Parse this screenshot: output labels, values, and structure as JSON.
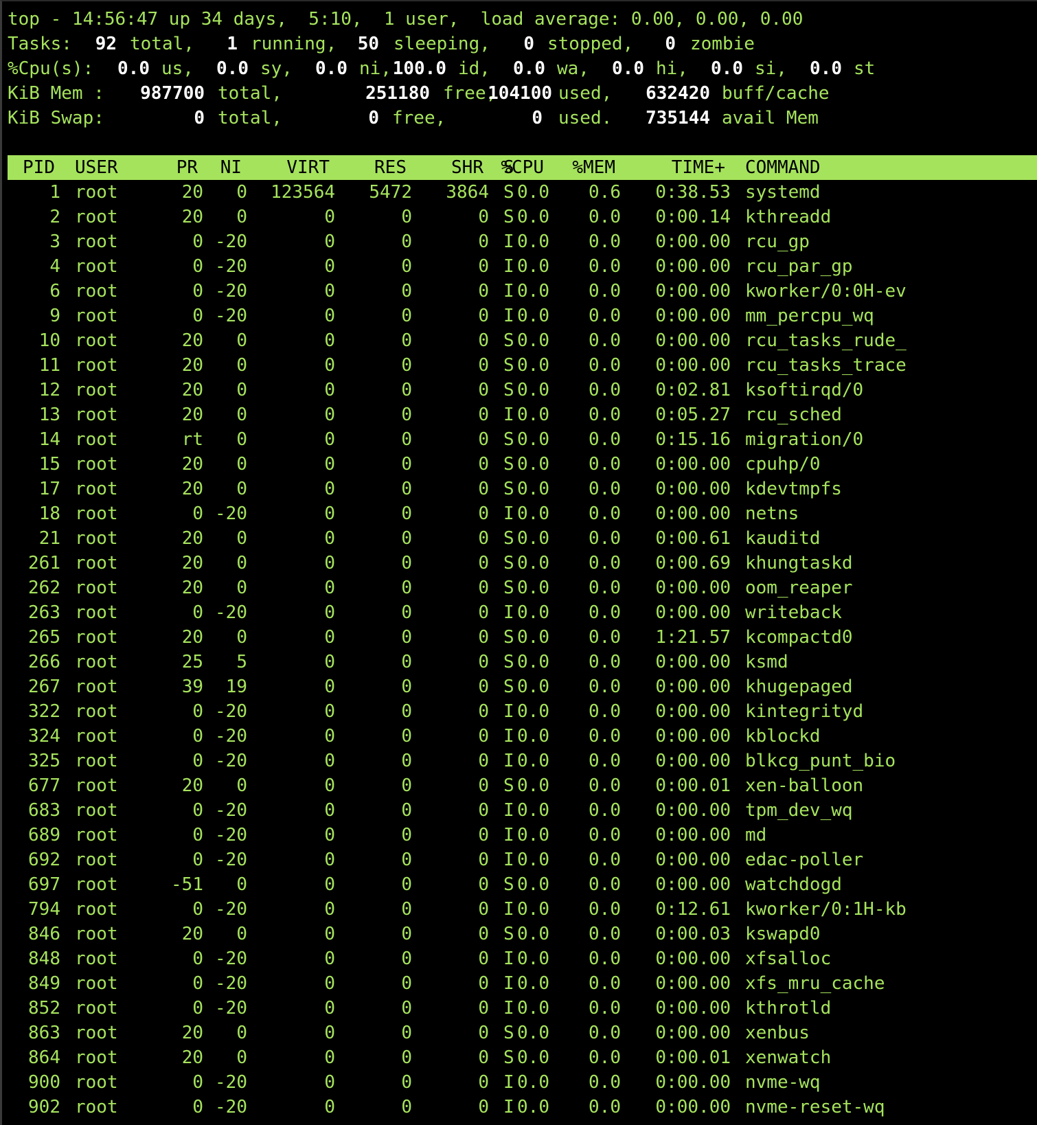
{
  "summary": {
    "line1": "top - 14:56:47 up 34 days,  5:10,  1 user,  load average: 0.00, 0.00, 0.00",
    "tasks": {
      "label": "Tasks:",
      "total": "92",
      "total_lbl": "total,",
      "running": "1",
      "running_lbl": "running,",
      "sleeping": "50",
      "sleeping_lbl": "sleeping,",
      "stopped": "0",
      "stopped_lbl": "stopped,",
      "zombie": "0",
      "zombie_lbl": "zombie"
    },
    "cpu": {
      "label": "%Cpu(s):",
      "us": "0.0",
      "us_lbl": "us,",
      "sy": "0.0",
      "sy_lbl": "sy,",
      "ni": "0.0",
      "ni_lbl": "ni,",
      "id": "100.0",
      "id_lbl": "id,",
      "wa": "0.0",
      "wa_lbl": "wa,",
      "hi": "0.0",
      "hi_lbl": "hi,",
      "si": "0.0",
      "si_lbl": "si,",
      "st": "0.0",
      "st_lbl": "st"
    },
    "mem": {
      "label": "KiB Mem :",
      "total": "987700",
      "total_lbl": "total,",
      "free": "251180",
      "free_lbl": "free,",
      "used": "104100",
      "used_lbl": "used,",
      "buff": "632420",
      "buff_lbl": "buff/cache"
    },
    "swap": {
      "label": "KiB Swap:",
      "total": "0",
      "total_lbl": "total,",
      "free": "0",
      "free_lbl": "free,",
      "used": "0",
      "used_lbl": "used.",
      "avail": "735144",
      "avail_lbl": "avail Mem"
    }
  },
  "columns": [
    "PID",
    "USER",
    "PR",
    "NI",
    "VIRT",
    "RES",
    "SHR",
    "S",
    "%CPU",
    "%MEM",
    "TIME+",
    "COMMAND"
  ],
  "processes": [
    [
      "1",
      "root",
      "20",
      "0",
      "123564",
      "5472",
      "3864",
      "S",
      "0.0",
      "0.6",
      "0:38.53",
      "systemd"
    ],
    [
      "2",
      "root",
      "20",
      "0",
      "0",
      "0",
      "0",
      "S",
      "0.0",
      "0.0",
      "0:00.14",
      "kthreadd"
    ],
    [
      "3",
      "root",
      "0",
      "-20",
      "0",
      "0",
      "0",
      "I",
      "0.0",
      "0.0",
      "0:00.00",
      "rcu_gp"
    ],
    [
      "4",
      "root",
      "0",
      "-20",
      "0",
      "0",
      "0",
      "I",
      "0.0",
      "0.0",
      "0:00.00",
      "rcu_par_gp"
    ],
    [
      "6",
      "root",
      "0",
      "-20",
      "0",
      "0",
      "0",
      "I",
      "0.0",
      "0.0",
      "0:00.00",
      "kworker/0:0H-ev"
    ],
    [
      "9",
      "root",
      "0",
      "-20",
      "0",
      "0",
      "0",
      "I",
      "0.0",
      "0.0",
      "0:00.00",
      "mm_percpu_wq"
    ],
    [
      "10",
      "root",
      "20",
      "0",
      "0",
      "0",
      "0",
      "S",
      "0.0",
      "0.0",
      "0:00.00",
      "rcu_tasks_rude_"
    ],
    [
      "11",
      "root",
      "20",
      "0",
      "0",
      "0",
      "0",
      "S",
      "0.0",
      "0.0",
      "0:00.00",
      "rcu_tasks_trace"
    ],
    [
      "12",
      "root",
      "20",
      "0",
      "0",
      "0",
      "0",
      "S",
      "0.0",
      "0.0",
      "0:02.81",
      "ksoftirqd/0"
    ],
    [
      "13",
      "root",
      "20",
      "0",
      "0",
      "0",
      "0",
      "I",
      "0.0",
      "0.0",
      "0:05.27",
      "rcu_sched"
    ],
    [
      "14",
      "root",
      "rt",
      "0",
      "0",
      "0",
      "0",
      "S",
      "0.0",
      "0.0",
      "0:15.16",
      "migration/0"
    ],
    [
      "15",
      "root",
      "20",
      "0",
      "0",
      "0",
      "0",
      "S",
      "0.0",
      "0.0",
      "0:00.00",
      "cpuhp/0"
    ],
    [
      "17",
      "root",
      "20",
      "0",
      "0",
      "0",
      "0",
      "S",
      "0.0",
      "0.0",
      "0:00.00",
      "kdevtmpfs"
    ],
    [
      "18",
      "root",
      "0",
      "-20",
      "0",
      "0",
      "0",
      "I",
      "0.0",
      "0.0",
      "0:00.00",
      "netns"
    ],
    [
      "21",
      "root",
      "20",
      "0",
      "0",
      "0",
      "0",
      "S",
      "0.0",
      "0.0",
      "0:00.61",
      "kauditd"
    ],
    [
      "261",
      "root",
      "20",
      "0",
      "0",
      "0",
      "0",
      "S",
      "0.0",
      "0.0",
      "0:00.69",
      "khungtaskd"
    ],
    [
      "262",
      "root",
      "20",
      "0",
      "0",
      "0",
      "0",
      "S",
      "0.0",
      "0.0",
      "0:00.00",
      "oom_reaper"
    ],
    [
      "263",
      "root",
      "0",
      "-20",
      "0",
      "0",
      "0",
      "I",
      "0.0",
      "0.0",
      "0:00.00",
      "writeback"
    ],
    [
      "265",
      "root",
      "20",
      "0",
      "0",
      "0",
      "0",
      "S",
      "0.0",
      "0.0",
      "1:21.57",
      "kcompactd0"
    ],
    [
      "266",
      "root",
      "25",
      "5",
      "0",
      "0",
      "0",
      "S",
      "0.0",
      "0.0",
      "0:00.00",
      "ksmd"
    ],
    [
      "267",
      "root",
      "39",
      "19",
      "0",
      "0",
      "0",
      "S",
      "0.0",
      "0.0",
      "0:00.00",
      "khugepaged"
    ],
    [
      "322",
      "root",
      "0",
      "-20",
      "0",
      "0",
      "0",
      "I",
      "0.0",
      "0.0",
      "0:00.00",
      "kintegrityd"
    ],
    [
      "324",
      "root",
      "0",
      "-20",
      "0",
      "0",
      "0",
      "I",
      "0.0",
      "0.0",
      "0:00.00",
      "kblockd"
    ],
    [
      "325",
      "root",
      "0",
      "-20",
      "0",
      "0",
      "0",
      "I",
      "0.0",
      "0.0",
      "0:00.00",
      "blkcg_punt_bio"
    ],
    [
      "677",
      "root",
      "20",
      "0",
      "0",
      "0",
      "0",
      "S",
      "0.0",
      "0.0",
      "0:00.01",
      "xen-balloon"
    ],
    [
      "683",
      "root",
      "0",
      "-20",
      "0",
      "0",
      "0",
      "I",
      "0.0",
      "0.0",
      "0:00.00",
      "tpm_dev_wq"
    ],
    [
      "689",
      "root",
      "0",
      "-20",
      "0",
      "0",
      "0",
      "I",
      "0.0",
      "0.0",
      "0:00.00",
      "md"
    ],
    [
      "692",
      "root",
      "0",
      "-20",
      "0",
      "0",
      "0",
      "I",
      "0.0",
      "0.0",
      "0:00.00",
      "edac-poller"
    ],
    [
      "697",
      "root",
      "-51",
      "0",
      "0",
      "0",
      "0",
      "S",
      "0.0",
      "0.0",
      "0:00.00",
      "watchdogd"
    ],
    [
      "794",
      "root",
      "0",
      "-20",
      "0",
      "0",
      "0",
      "I",
      "0.0",
      "0.0",
      "0:12.61",
      "kworker/0:1H-kb"
    ],
    [
      "846",
      "root",
      "20",
      "0",
      "0",
      "0",
      "0",
      "S",
      "0.0",
      "0.0",
      "0:00.03",
      "kswapd0"
    ],
    [
      "848",
      "root",
      "0",
      "-20",
      "0",
      "0",
      "0",
      "I",
      "0.0",
      "0.0",
      "0:00.00",
      "xfsalloc"
    ],
    [
      "849",
      "root",
      "0",
      "-20",
      "0",
      "0",
      "0",
      "I",
      "0.0",
      "0.0",
      "0:00.00",
      "xfs_mru_cache"
    ],
    [
      "852",
      "root",
      "0",
      "-20",
      "0",
      "0",
      "0",
      "I",
      "0.0",
      "0.0",
      "0:00.00",
      "kthrotld"
    ],
    [
      "863",
      "root",
      "20",
      "0",
      "0",
      "0",
      "0",
      "S",
      "0.0",
      "0.0",
      "0:00.00",
      "xenbus"
    ],
    [
      "864",
      "root",
      "20",
      "0",
      "0",
      "0",
      "0",
      "S",
      "0.0",
      "0.0",
      "0:00.01",
      "xenwatch"
    ],
    [
      "900",
      "root",
      "0",
      "-20",
      "0",
      "0",
      "0",
      "I",
      "0.0",
      "0.0",
      "0:00.00",
      "nvme-wq"
    ],
    [
      "902",
      "root",
      "0",
      "-20",
      "0",
      "0",
      "0",
      "I",
      "0.0",
      "0.0",
      "0:00.00",
      "nvme-reset-wq"
    ]
  ],
  "colors": {
    "text": "#a6e35d",
    "bold_value": "#ffffff",
    "header_bg": "#a6e35d",
    "background": "#000000"
  }
}
